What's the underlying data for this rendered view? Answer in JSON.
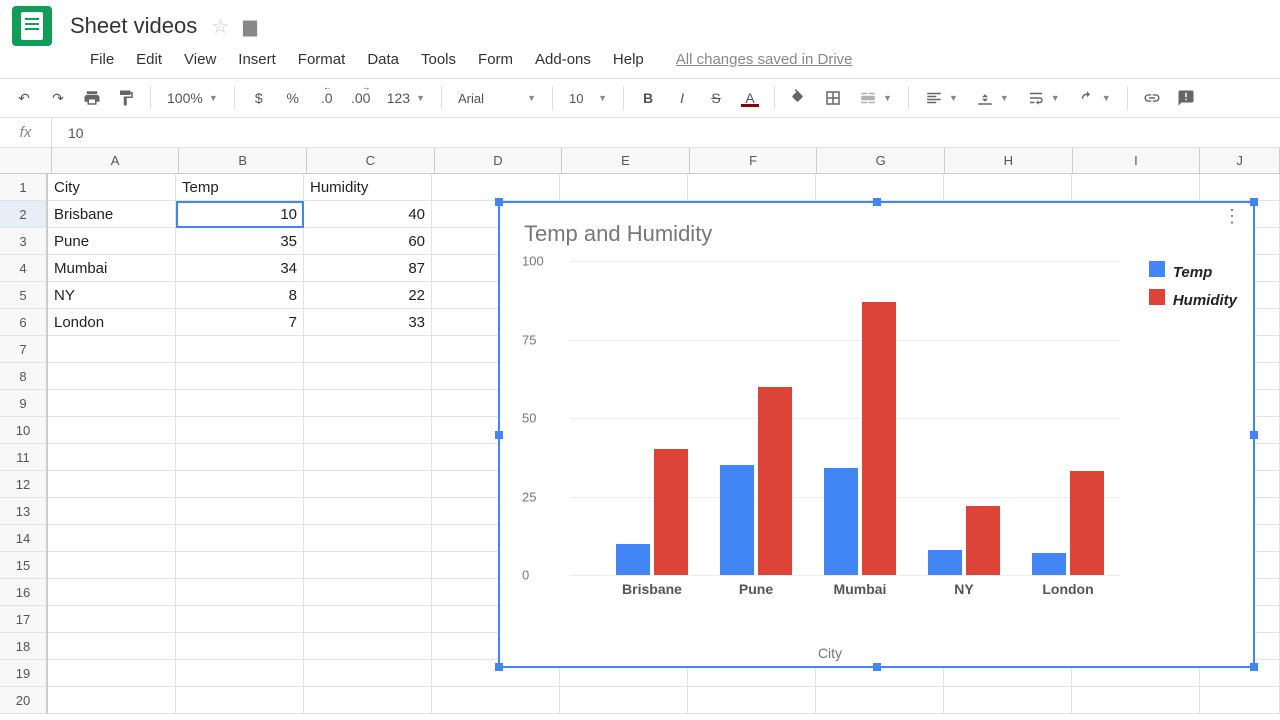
{
  "doc": {
    "title": "Sheet videos",
    "saved": "All changes saved in Drive"
  },
  "menus": {
    "file": "File",
    "edit": "Edit",
    "view": "View",
    "insert": "Insert",
    "format": "Format",
    "data": "Data",
    "tools": "Tools",
    "form": "Form",
    "addons": "Add-ons",
    "help": "Help"
  },
  "toolbar": {
    "zoom": "100%",
    "curr": "$",
    "pct": "%",
    "dec0": ".0",
    "dec00": ".00",
    "num": "123",
    "font": "Arial",
    "size": "10",
    "bold": "B",
    "italic": "I",
    "strike": "S",
    "textA": "A"
  },
  "fx": {
    "label": "fx",
    "value": "10"
  },
  "columns": [
    "A",
    "B",
    "C",
    "D",
    "E",
    "F",
    "G",
    "H",
    "I",
    "J"
  ],
  "rows": [
    "1",
    "2",
    "3",
    "4",
    "5",
    "6",
    "7",
    "8",
    "9",
    "10",
    "11",
    "12",
    "13",
    "14",
    "15",
    "16",
    "17",
    "18",
    "19",
    "20"
  ],
  "table": {
    "headers": {
      "city": "City",
      "temp": "Temp",
      "humidity": "Humidity"
    },
    "data": [
      {
        "city": "Brisbane",
        "temp": "10",
        "humidity": "40"
      },
      {
        "city": "Pune",
        "temp": "35",
        "humidity": "60"
      },
      {
        "city": "Mumbai",
        "temp": "34",
        "humidity": "87"
      },
      {
        "city": "NY",
        "temp": "8",
        "humidity": "22"
      },
      {
        "city": "London",
        "temp": "7",
        "humidity": "33"
      }
    ]
  },
  "chart_data": {
    "type": "bar",
    "title": "Temp and Humidity",
    "xlabel": "City",
    "ylabel": "",
    "ylim": [
      0,
      100
    ],
    "yticks": [
      0,
      25,
      50,
      75,
      100
    ],
    "categories": [
      "Brisbane",
      "Pune",
      "Mumbai",
      "NY",
      "London"
    ],
    "series": [
      {
        "name": "Temp",
        "color": "#4285f4",
        "values": [
          10,
          35,
          34,
          8,
          7
        ]
      },
      {
        "name": "Humidity",
        "color": "#db4437",
        "values": [
          40,
          60,
          87,
          22,
          33
        ]
      }
    ],
    "legend_position": "right"
  },
  "colors": {
    "temp": "#4285f4",
    "humidity": "#db4437"
  }
}
